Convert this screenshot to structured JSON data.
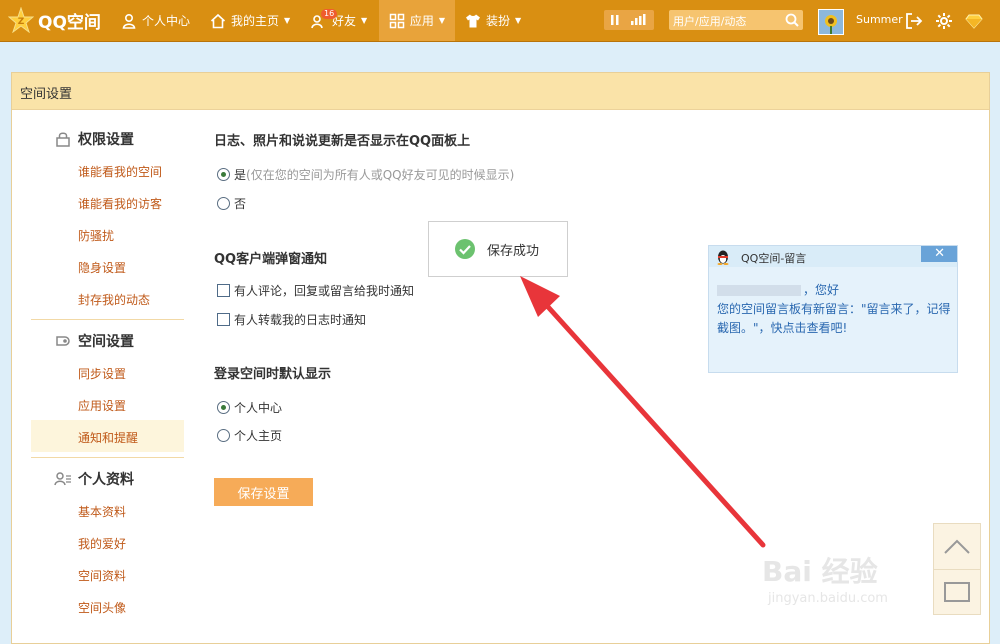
{
  "topbar": {
    "logo": "QQ空间",
    "nav": [
      {
        "label": "个人中心",
        "icon": "person-icon",
        "caret": false
      },
      {
        "label": "我的主页",
        "icon": "home-icon",
        "caret": true
      },
      {
        "label": "好友",
        "icon": "friends-icon",
        "caret": true,
        "badge": "16"
      },
      {
        "label": "应用",
        "icon": "apps-icon",
        "caret": true,
        "active": true
      },
      {
        "label": "装扮",
        "icon": "shirt-icon",
        "caret": true
      }
    ],
    "search_placeholder": "用户/应用/动态",
    "username": "Summer"
  },
  "panel": {
    "title": "空间设置"
  },
  "sidebar": {
    "groups": [
      {
        "heading": "权限设置",
        "icon": "lock-icon",
        "items": [
          "谁能看我的空间",
          "谁能看我的访客",
          "防骚扰",
          "隐身设置",
          "封存我的动态"
        ]
      },
      {
        "heading": "空间设置",
        "icon": "settings-icon",
        "items": [
          "同步设置",
          "应用设置",
          "通知和提醒"
        ],
        "active_item": "通知和提醒"
      },
      {
        "heading": "个人资料",
        "icon": "profile-icon",
        "items": [
          "基本资料",
          "我的爱好",
          "空间资料",
          "空间头像"
        ]
      }
    ]
  },
  "settings": {
    "qq_panel": {
      "title": "日志、照片和说说更新是否显示在QQ面板上",
      "options": [
        {
          "label": "是",
          "hint": "(仅在您的空间为所有人或QQ好友可见的时候显示)",
          "selected": true
        },
        {
          "label": "否",
          "hint": "",
          "selected": false
        }
      ]
    },
    "popup_notify": {
      "title": "QQ客户端弹窗通知",
      "options": [
        {
          "label": "有人评论，回复或留言给我时通知",
          "checked": false
        },
        {
          "label": "有人转载我的日志时通知",
          "checked": false
        }
      ]
    },
    "login_default": {
      "title": "登录空间时默认显示",
      "options": [
        {
          "label": "个人中心",
          "selected": true
        },
        {
          "label": "个人主页",
          "selected": false
        }
      ]
    },
    "save_label": "保存设置"
  },
  "toast": {
    "text": "保存成功"
  },
  "qq_popup": {
    "title": "QQ空间-留言",
    "greeting": "，您好",
    "message": "您的空间留言板有新留言：\"留言来了，记得截图。\"，快点击查看吧!"
  },
  "watermark": {
    "main": "Bai 经验",
    "sub": "jingyan.baidu.com"
  },
  "colors": {
    "topbar": "#d98f12",
    "panel_header": "#fae3a8",
    "save_button": "#f6ab58",
    "link": "#c05a1a",
    "arrow": "#e8353a"
  }
}
